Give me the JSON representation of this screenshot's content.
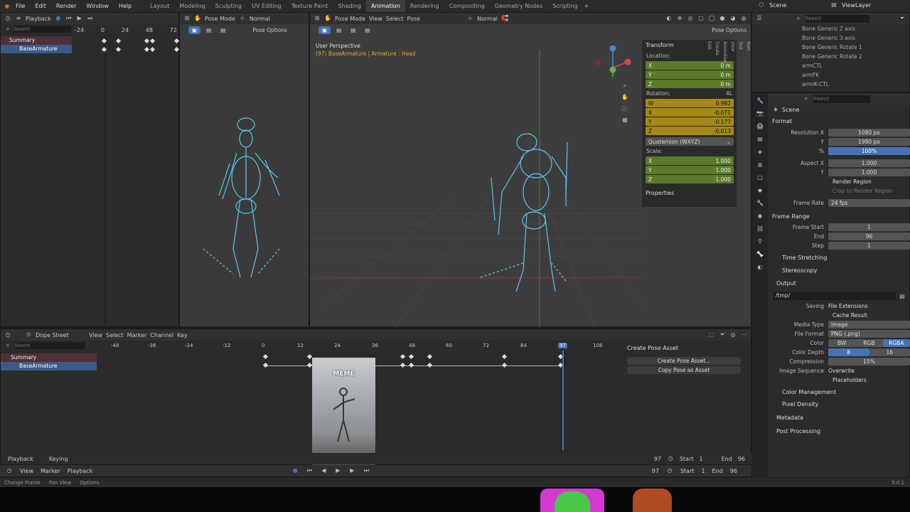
{
  "menu": {
    "items": [
      "File",
      "Edit",
      "Render",
      "Window",
      "Help"
    ]
  },
  "workspaces": {
    "tabs": [
      "Layout",
      "Modeling",
      "Sculpting",
      "UV Editing",
      "Texture Paint",
      "Shading",
      "Animation",
      "Rendering",
      "Compositing",
      "Geometry Nodes",
      "Scripting"
    ],
    "active": "Animation",
    "scene": "Scene",
    "view_layer": "ViewLayer"
  },
  "small_dope": {
    "playback": "Playback",
    "search_ph": "Search",
    "rows": [
      "Summary",
      "BaseArmature"
    ],
    "ticks": [
      "-24",
      "0",
      "24",
      "48",
      "72"
    ]
  },
  "left_view": {
    "mode": "Pose Mode",
    "shading": "Normal",
    "options": "Pose Options"
  },
  "main_view": {
    "mode": "Pose Mode",
    "shading": "Normal",
    "menus": [
      "View",
      "Select",
      "Pose"
    ],
    "title": "User Perspective",
    "subtitle": "(97) BaseArmature | Armature : Head",
    "options": "Pose Options"
  },
  "npanel": {
    "transform": "Transform",
    "location": "Location:",
    "loc": {
      "x": "0 m",
      "y": "0 m",
      "z": "0 m"
    },
    "rotation": "Rotation:",
    "rot_mode": "4L",
    "rot": {
      "w": "0.982",
      "x": "-0.071",
      "y": "-0.177",
      "z": "-0.013"
    },
    "quat": "Quaternion (WXYZ)",
    "scale": "Scale:",
    "scl": {
      "x": "1.000",
      "y": "1.000",
      "z": "1.000"
    },
    "properties": "Properties",
    "tabs": [
      "Item",
      "Tool",
      "View",
      "Animation",
      "Create",
      "Edit"
    ],
    "axis_labels": {
      "w": "W",
      "x": "X",
      "y": "Y",
      "z": "Z"
    }
  },
  "outliner": {
    "search_ph": "Search",
    "items": [
      "Bone Generic 2 axis",
      "Bone Generic 3 axis",
      "Bone Generic Rotate 1",
      "Bone Generic Rotate 2",
      "armCTL",
      "armFK",
      "armIK-CTL"
    ]
  },
  "props": {
    "search_ph": "Search",
    "scene": "Scene",
    "format": "Format",
    "res_x_lbl": "Resolution X",
    "res_x": "1080 px",
    "res_y_lbl": "Y",
    "res_y": "1980 px",
    "pct_lbl": "%",
    "pct": "100%",
    "aspect_x_lbl": "Aspect X",
    "aspect_x": "1.000",
    "aspect_y_lbl": "Y",
    "aspect_y": "1.000",
    "render_region": "Render Region",
    "crop": "Crop to Render Region",
    "frame_rate_lbl": "Frame Rate",
    "frame_rate": "24 fps",
    "frame_range": "Frame Range",
    "start_lbl": "Frame Start",
    "start": "1",
    "end_lbl": "End",
    "end": "96",
    "step_lbl": "Step",
    "step": "1",
    "time_stretch": "Time Stretching",
    "stereo": "Stereoscopy",
    "output": "Output",
    "path": "/tmp/",
    "saving_lbl": "Saving",
    "file_ext": "File Extensions",
    "cache": "Cache Result",
    "media_lbl": "Media Type",
    "media": "Image",
    "fformat_lbl": "File Format",
    "fformat": "PNG (.png)",
    "color_lbl": "Color",
    "color_opts": [
      "BW",
      "RGB",
      "RGBA"
    ],
    "depth_lbl": "Color Depth",
    "depth_opts": [
      "8",
      "16"
    ],
    "comp_lbl": "Compression",
    "comp": "15%",
    "seq_lbl": "Image Sequence",
    "overwrite": "Overwrite",
    "placeholders": "Placeholders",
    "color_mgmt": "Color Management",
    "pixel_density": "Pixel Density",
    "metadata": "Metadata",
    "post": "Post Processing"
  },
  "dopesheet": {
    "mode": "Dope Sheet",
    "menus": [
      "View",
      "Select",
      "Marker",
      "Channel",
      "Key"
    ],
    "search_ph": "Search",
    "rows": [
      "Summary",
      "BaseArmature"
    ],
    "ticks": [
      "-48",
      "-36",
      "-24",
      "-12",
      "0",
      "12",
      "24",
      "36",
      "48",
      "60",
      "72",
      "84",
      "97",
      "108"
    ],
    "current_frame": "97",
    "side_title": "Create Pose Asset",
    "create_btn": "Create Pose Asset...",
    "copy_btn": "Copy Pose as Asset",
    "playback": "Playback",
    "keying": "Keying",
    "frame": "97",
    "start_lbl": "Start",
    "start": "1",
    "end_lbl": "End",
    "end": "96",
    "meme_text": "MEME"
  },
  "timeline": {
    "menus": [
      "View",
      "Marker",
      "Playback"
    ],
    "frame": "97",
    "start_lbl": "Start",
    "start": "1",
    "end_lbl": "End",
    "end": "96"
  },
  "status": {
    "items": [
      "Change Frame",
      "Pan View",
      "Options"
    ],
    "version": "5.0.1"
  },
  "colors": {
    "accent": "#4772b3",
    "armature": "#5ac8f0",
    "green_field": "#5b7a2a",
    "yellow_field": "#a58a16"
  }
}
